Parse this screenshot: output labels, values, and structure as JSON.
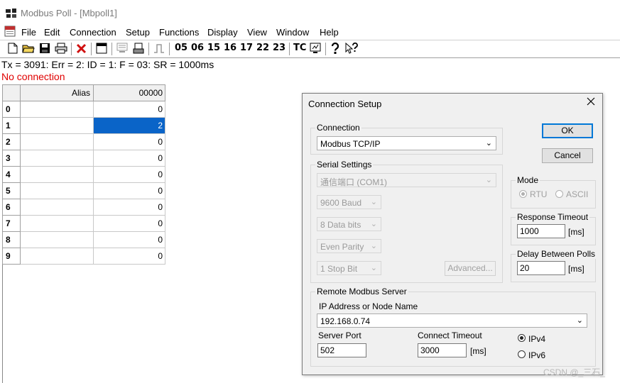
{
  "window": {
    "title": "Modbus Poll - [Mbpoll1]"
  },
  "menu": [
    "File",
    "Edit",
    "Connection",
    "Setup",
    "Functions",
    "Display",
    "View",
    "Window",
    "Help"
  ],
  "toolbar": {
    "codes": [
      "05",
      "06",
      "15",
      "16",
      "17",
      "22",
      "23"
    ],
    "tc": "TC"
  },
  "status": {
    "line1": "Tx = 3091: Err = 2: ID = 1: F = 03: SR = 1000ms",
    "line2": "No connection"
  },
  "grid": {
    "headers": {
      "alias": "Alias",
      "col": "00000"
    },
    "rows": [
      {
        "idx": "0",
        "value": "0"
      },
      {
        "idx": "1",
        "value": "2"
      },
      {
        "idx": "2",
        "value": "0"
      },
      {
        "idx": "3",
        "value": "0"
      },
      {
        "idx": "4",
        "value": "0"
      },
      {
        "idx": "5",
        "value": "0"
      },
      {
        "idx": "6",
        "value": "0"
      },
      {
        "idx": "7",
        "value": "0"
      },
      {
        "idx": "8",
        "value": "0"
      },
      {
        "idx": "9",
        "value": "0"
      }
    ],
    "selected_row": 1,
    "selected_color": "#0a64c8"
  },
  "dialog": {
    "title": "Connection Setup",
    "ok": "OK",
    "cancel": "Cancel",
    "connection": {
      "label": "Connection",
      "value": "Modbus TCP/IP"
    },
    "serial": {
      "label": "Serial Settings",
      "port": "通信端口 (COM1)",
      "baud": "9600 Baud",
      "databits": "8 Data bits",
      "parity": "Even Parity",
      "stopbits": "1 Stop Bit",
      "advanced": "Advanced..."
    },
    "mode": {
      "label": "Mode",
      "rtu": "RTU",
      "ascii": "ASCII"
    },
    "response_timeout": {
      "label": "Response Timeout",
      "value": "1000",
      "unit": "[ms]"
    },
    "delay_polls": {
      "label": "Delay Between Polls",
      "value": "20",
      "unit": "[ms]"
    },
    "remote": {
      "label": "Remote Modbus Server",
      "ip_label": "IP Address or Node Name",
      "ip_value": "192.168.0.74",
      "port_label": "Server Port",
      "port_value": "502",
      "connect_timeout_label": "Connect Timeout",
      "connect_timeout_value": "3000",
      "connect_timeout_unit": "[ms]",
      "ipv4": "IPv4",
      "ipv6": "IPv6"
    }
  },
  "watermark": "CSDN @_三石_"
}
